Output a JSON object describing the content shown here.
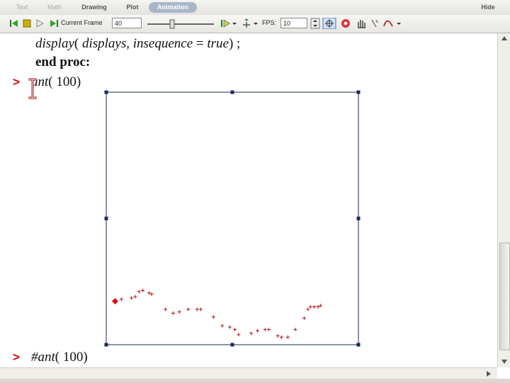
{
  "tabs": [
    {
      "label": "Text",
      "state": "dim"
    },
    {
      "label": "Math",
      "state": "dim"
    },
    {
      "label": "Drawing",
      "state": "normal"
    },
    {
      "label": "Plot",
      "state": "normal"
    },
    {
      "label": "Animation",
      "state": "active"
    }
  ],
  "hide_label": "Hide",
  "toolbar": {
    "current_frame_label": "Current Frame",
    "current_frame_value": "40",
    "fps_label": "FPS:",
    "fps_value": "10"
  },
  "worksheet": {
    "line1_cmd": "display",
    "line1_args": "displays, ",
    "line1_kw": "insequence",
    "line1_val": "true",
    "line2": "end proc",
    "prompt_symbol": ">",
    "input1_name": "ant",
    "input1_arg": "100",
    "input2_name": "#ant",
    "input2_arg": "100"
  },
  "chart_data": {
    "type": "scatter",
    "title": "",
    "xlabel": "",
    "ylabel": "",
    "xlim": [
      0,
      100
    ],
    "ylim": [
      0,
      100
    ],
    "marker": "+",
    "point_color": "#b01818",
    "ant_color": "#e01010",
    "ant": {
      "x": 3.5,
      "y": 17.2
    },
    "points": [
      {
        "x": 6,
        "y": 18
      },
      {
        "x": 10,
        "y": 18.5
      },
      {
        "x": 11.5,
        "y": 19
      },
      {
        "x": 13,
        "y": 21
      },
      {
        "x": 14.5,
        "y": 21.5
      },
      {
        "x": 17,
        "y": 20.5
      },
      {
        "x": 18,
        "y": 20
      },
      {
        "x": 23.5,
        "y": 14
      },
      {
        "x": 26.5,
        "y": 12.5
      },
      {
        "x": 29,
        "y": 13
      },
      {
        "x": 32.5,
        "y": 14
      },
      {
        "x": 36,
        "y": 14
      },
      {
        "x": 37.5,
        "y": 14
      },
      {
        "x": 42.5,
        "y": 11
      },
      {
        "x": 46,
        "y": 7.5
      },
      {
        "x": 49,
        "y": 7
      },
      {
        "x": 51,
        "y": 6
      },
      {
        "x": 52.5,
        "y": 4
      },
      {
        "x": 57.5,
        "y": 4.5
      },
      {
        "x": 60,
        "y": 5.5
      },
      {
        "x": 63,
        "y": 6
      },
      {
        "x": 64.5,
        "y": 6
      },
      {
        "x": 68,
        "y": 3.5
      },
      {
        "x": 69.5,
        "y": 3
      },
      {
        "x": 72,
        "y": 3
      },
      {
        "x": 75,
        "y": 6
      },
      {
        "x": 78.5,
        "y": 10.5
      },
      {
        "x": 80,
        "y": 14
      },
      {
        "x": 81,
        "y": 15
      },
      {
        "x": 82.5,
        "y": 15
      },
      {
        "x": 84,
        "y": 15
      },
      {
        "x": 85,
        "y": 15.5
      }
    ]
  }
}
